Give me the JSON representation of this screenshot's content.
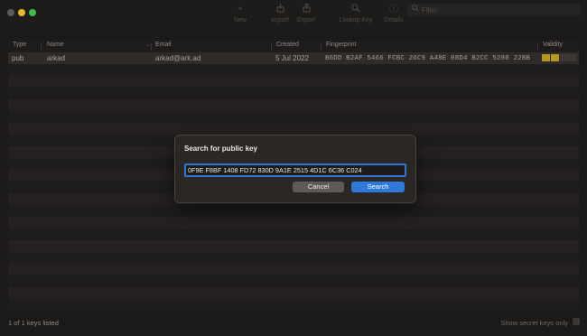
{
  "toolbar": {
    "new_label": "New",
    "import_label": "Import",
    "export_label": "Export",
    "lookup_label": "Lookup Key",
    "details_label": "Details",
    "filter_placeholder": "Filter",
    "icons": [
      "plus-icon",
      "import-icon",
      "export-icon",
      "lookup-key-icon",
      "details-icon",
      "search-icon"
    ]
  },
  "table": {
    "columns": [
      "Type",
      "Name",
      "Email",
      "Created",
      "Fingerprint",
      "Validity"
    ],
    "rows": [
      {
        "type": "pub",
        "name": "arkad",
        "email": "arkad@ark.ad",
        "created": "5 Jul 2022",
        "fingerprint": "B6DD B2AF 5466 FCBC 26C9  A48E 08D4 B2CC 5280 22BB"
      }
    ]
  },
  "footer": {
    "count": "1 of 1 keys listed",
    "secret_label": "Show secret keys only"
  },
  "dialog": {
    "title": "Search for public key",
    "input_value": "0F9E F8BF 1408 FD72 830D 9A1E 2515 4D1C 6C36 C024",
    "cancel_label": "Cancel",
    "search_label": "Search"
  },
  "colors": {
    "accent": "#2f7ad9",
    "validity_filled": "#b8951f",
    "validity_empty": "#3a3735",
    "window_bg": "#1c1a19"
  }
}
